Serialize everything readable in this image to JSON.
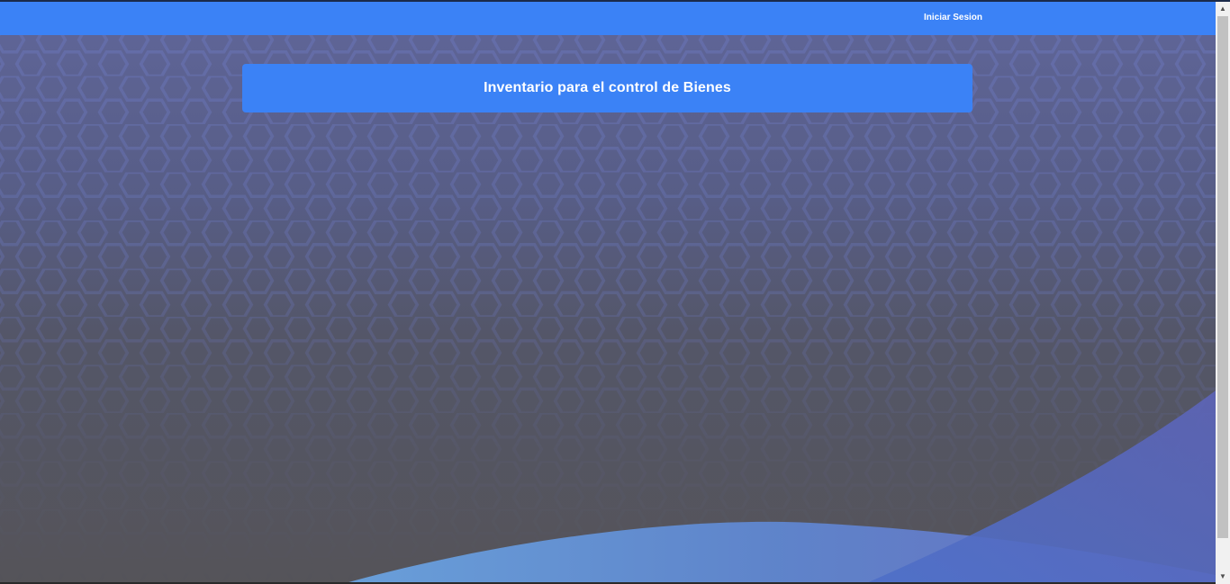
{
  "navbar": {
    "login_label": "Iniciar Sesion"
  },
  "main": {
    "title": "Inventario para el control de Bienes"
  },
  "scrollbar": {
    "up_icon": "▲",
    "down_icon": "▼"
  },
  "colors": {
    "accent": "#3b82f6",
    "background_top": "#5e6496",
    "background_bottom": "#555459"
  }
}
